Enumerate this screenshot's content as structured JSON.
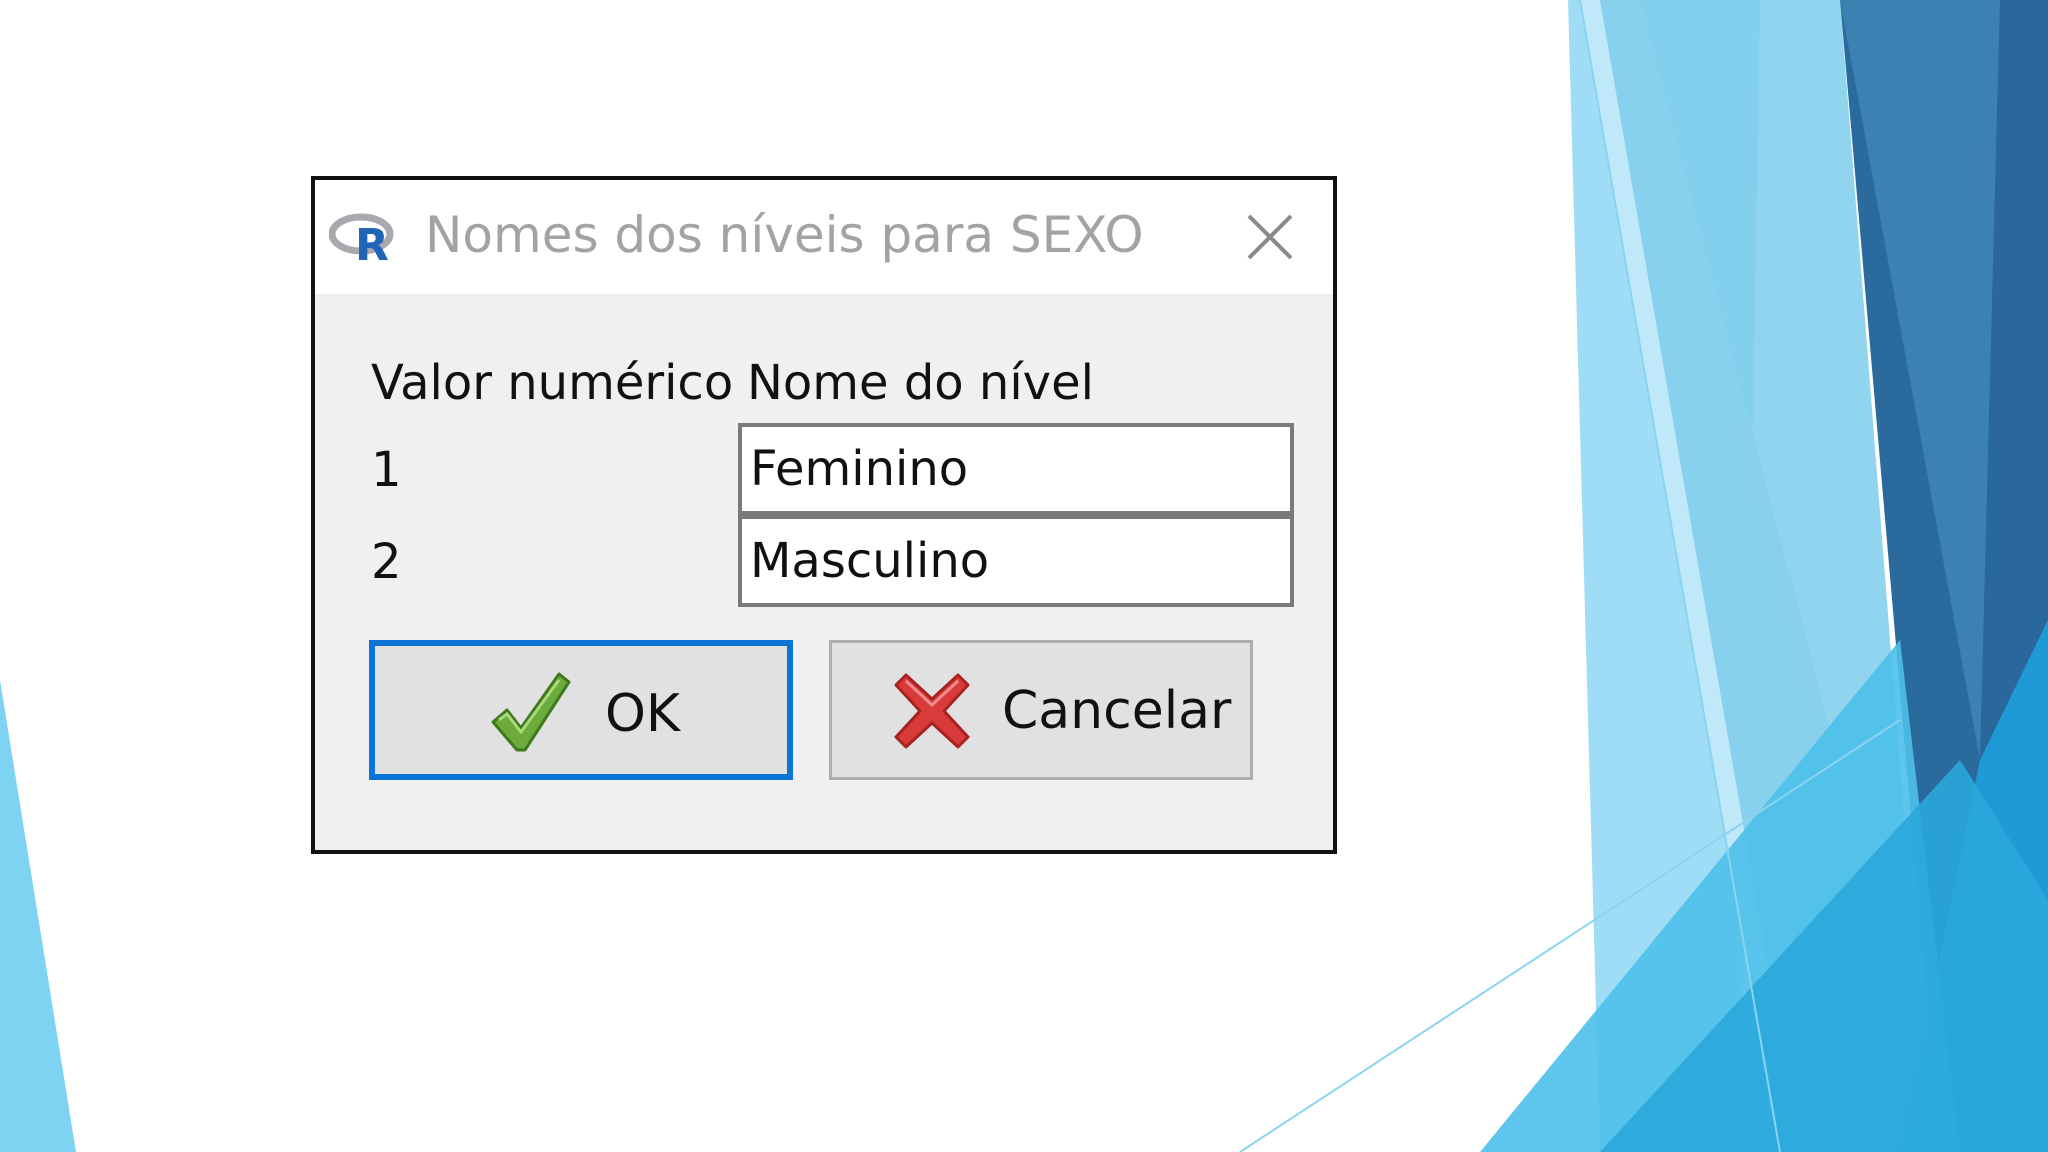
{
  "dialog": {
    "title": "Nomes dos níveis para SEXO",
    "app_icon": "r-logo-icon",
    "close_icon": "close-icon",
    "headers": {
      "value": "Valor numérico",
      "name": "Nome do nível"
    },
    "rows": [
      {
        "value": "1",
        "name": "Feminino"
      },
      {
        "value": "2",
        "name": "Masculino"
      }
    ],
    "buttons": {
      "ok": {
        "label": "OK",
        "icon": "checkmark-icon"
      },
      "cancel": {
        "label": "Cancelar",
        "icon": "red-x-icon"
      }
    }
  },
  "colors": {
    "focus_border": "#0a74d6",
    "title_text": "#a3a3a3",
    "dialog_bg": "#f0f0f0",
    "accent_blue_light": "#7fd0f0",
    "accent_blue_dark": "#2b6a9c"
  }
}
